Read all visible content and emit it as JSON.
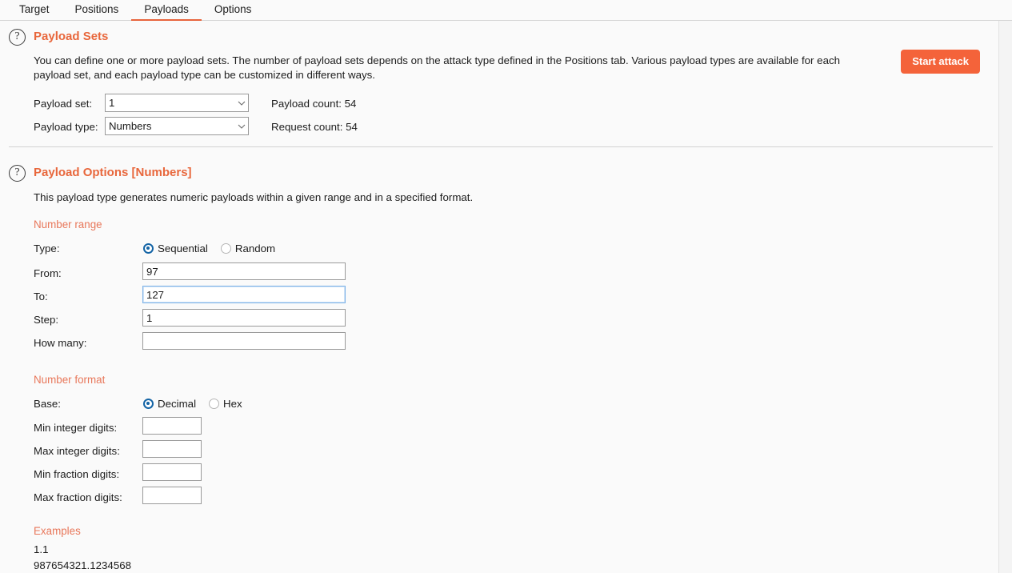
{
  "tabs": [
    {
      "label": "Target",
      "active": false
    },
    {
      "label": "Positions",
      "active": false
    },
    {
      "label": "Payloads",
      "active": true
    },
    {
      "label": "Options",
      "active": false
    }
  ],
  "payload_sets": {
    "heading": "Payload Sets",
    "help_icon": "question-mark-icon",
    "description": "You can define one or more payload sets. The number of payload sets depends on the attack type defined in the Positions tab. Various payload types are available for each payload set, and each payload type can be customized in different ways.",
    "start_attack_label": "Start attack",
    "payload_set_label": "Payload set:",
    "payload_set_value": "1",
    "payload_set_options": [
      "1"
    ],
    "payload_type_label": "Payload type:",
    "payload_type_value": "Numbers",
    "payload_type_options": [
      "Numbers"
    ],
    "payload_count_label": "Payload count: 54",
    "request_count_label": "Request count: 54"
  },
  "payload_options": {
    "heading": "Payload Options [Numbers]",
    "help_icon": "question-mark-icon",
    "description": "This payload type generates numeric payloads within a given range and in a specified format.",
    "number_range": {
      "subhead": "Number range",
      "type_label": "Type:",
      "type_options": [
        {
          "label": "Sequential",
          "selected": true
        },
        {
          "label": "Random",
          "selected": false
        }
      ],
      "from_label": "From:",
      "from_value": "97",
      "to_label": "To:",
      "to_value": "127",
      "to_focused": true,
      "step_label": "Step:",
      "step_value": "1",
      "how_many_label": "How many:",
      "how_many_value": ""
    },
    "number_format": {
      "subhead": "Number format",
      "base_label": "Base:",
      "base_options": [
        {
          "label": "Decimal",
          "selected": true
        },
        {
          "label": "Hex",
          "selected": false
        }
      ],
      "min_integer_label": "Min integer digits:",
      "min_integer_value": "",
      "max_integer_label": "Max integer digits:",
      "max_integer_value": "",
      "min_fraction_label": "Min fraction digits:",
      "min_fraction_value": "",
      "max_fraction_label": "Max fraction digits:",
      "max_fraction_value": ""
    },
    "examples": {
      "subhead": "Examples",
      "lines": [
        "1.1",
        "987654321.1234568"
      ]
    }
  },
  "colors": {
    "accent_orange": "#e8673c",
    "button_orange": "#f4633a",
    "subhead_orange": "#e8775a",
    "radio_blue": "#1464a5",
    "focus_blue": "#7eb4e8",
    "background": "#fafafa"
  }
}
